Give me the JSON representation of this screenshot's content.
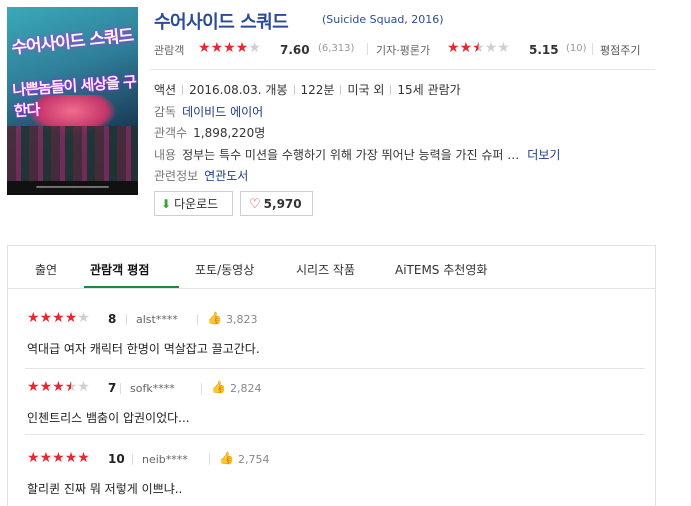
{
  "movie": {
    "title": "수어사이드 스쿼드",
    "original": "(Suicide Squad, 2016)",
    "poster_text_1": "수어사이드 스쿼드",
    "poster_text_2": "나쁜놈들이 세상을 구한다"
  },
  "ratings": {
    "audience_label": "관람객",
    "audience_stars": 4,
    "audience_score": "7.60",
    "audience_count": "(6,313)",
    "critic_label": "기자·평론가",
    "critic_stars": 2.5,
    "critic_score": "5.15",
    "critic_count": "(10)",
    "my_rating_label": "평점주기"
  },
  "info": {
    "genre": "액션",
    "release": "2016.08.03. 개봉",
    "runtime": "122분",
    "country": "미국 외",
    "age": "15세 관람가",
    "director_label": "감독",
    "director": "데이비드 에이어",
    "audience_label": "관객수",
    "audience_total": "1,898,220명",
    "content_label": "내용",
    "content": "정부는 특수 미션을 수행하기 위해 가장 뛰어난 능력을 가진 슈퍼 …",
    "more": "더보기",
    "related_label": "관련정보",
    "related": "연관도서"
  },
  "buttons": {
    "download": "다운로드",
    "like_count": "5,970"
  },
  "tabs": [
    "출연",
    "관람객 평점",
    "포토/동영상",
    "시리즈 작품",
    "AiTEMS 추천영화"
  ],
  "active_tab": 1,
  "reviews": [
    {
      "stars": 4,
      "score": "8",
      "user": "alst****",
      "likes": "3,823",
      "text": "역대급 여자 캐릭터 한명이 멱살잡고 끌고간다."
    },
    {
      "stars": 3.5,
      "score": "7",
      "user": "sofk****",
      "likes": "2,824",
      "text": "인첸트리스 뱀춤이 압권이었다..."
    },
    {
      "stars": 5,
      "score": "10",
      "user": "neib****",
      "likes": "2,754",
      "text": "할리퀸 진짜 뭐 저렇게 이쁘냐.."
    }
  ],
  "colors": {
    "accent_red": "#e8272f",
    "link_blue": "#2b4c99",
    "tab_green": "#1c8a3c"
  }
}
